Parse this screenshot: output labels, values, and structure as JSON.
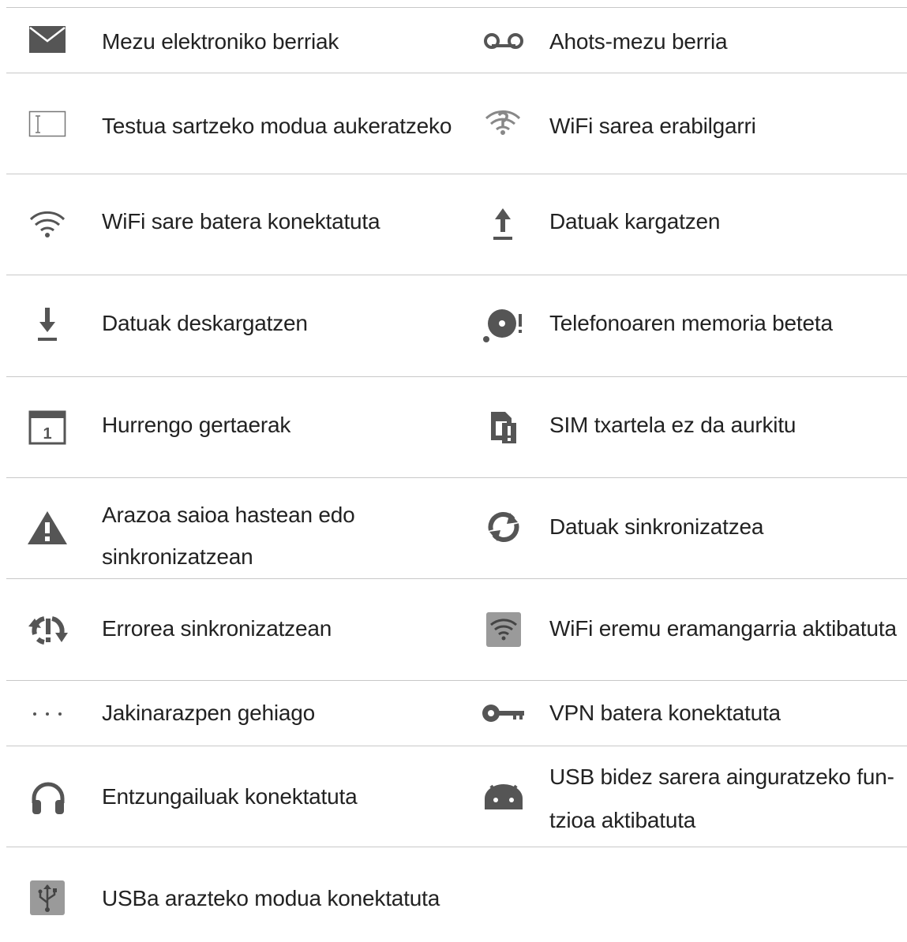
{
  "rows": [
    {
      "left": {
        "icon": "envelope-icon",
        "label": [
          "Mezu elektroniko berriak"
        ]
      },
      "right": {
        "icon": "voicemail-icon",
        "label": [
          "Ahots-mezu berria"
        ]
      }
    },
    {
      "left": {
        "icon": "text-input-icon",
        "label": [
          "Testua sartzeko modua aukeratzeko"
        ]
      },
      "right": {
        "icon": "wifi-question-icon",
        "label": [
          "WiFi sarea erabilgarri"
        ]
      }
    },
    {
      "left": {
        "icon": "wifi-icon",
        "label": [
          "WiFi sare batera konektatuta"
        ]
      },
      "right": {
        "icon": "upload-icon",
        "label": [
          "Datuak kargatzen"
        ]
      }
    },
    {
      "left": {
        "icon": "download-icon",
        "label": [
          "Datuak deskargatzen"
        ]
      },
      "right": {
        "icon": "storage-full-icon",
        "label": [
          "Telefonoaren memoria beteta"
        ]
      }
    },
    {
      "left": {
        "icon": "calendar-icon",
        "label": [
          "Hurrengo gertaerak"
        ],
        "calendar_day": "1"
      },
      "right": {
        "icon": "sim-missing-icon",
        "label": [
          "SIM txartela ez da aurkitu"
        ]
      }
    },
    {
      "left": {
        "icon": "warning-icon",
        "label": [
          "Arazoa saioa hastean edo",
          "sinkronizatzean"
        ]
      },
      "right": {
        "icon": "sync-icon",
        "label": [
          "Datuak sinkronizatzea"
        ]
      }
    },
    {
      "left": {
        "icon": "sync-error-icon",
        "label": [
          "Errorea sinkronizatzean"
        ]
      },
      "right": {
        "icon": "wifi-hotspot-icon",
        "label": [
          "WiFi eremu eramangarria aktibatuta"
        ]
      }
    },
    {
      "left": {
        "icon": "more-dots-icon",
        "label": [
          "Jakinarazpen gehiago"
        ]
      },
      "right": {
        "icon": "vpn-key-icon",
        "label": [
          "VPN batera konektatuta"
        ]
      }
    },
    {
      "left": {
        "icon": "headphones-icon",
        "label": [
          "Entzungailuak konektatuta"
        ]
      },
      "right": {
        "icon": "usb-tether-android-icon",
        "label": [
          "USB bidez sarera ainguratzeko fun-",
          "tzioa aktibatuta"
        ]
      }
    },
    {
      "left": {
        "icon": "usb-debug-icon",
        "label": [
          "USBa arazteko modua konektatuta"
        ]
      },
      "right": null
    }
  ],
  "colors": {
    "icon": "#555555",
    "divider": "#c8c8c8",
    "text": "#222222"
  }
}
